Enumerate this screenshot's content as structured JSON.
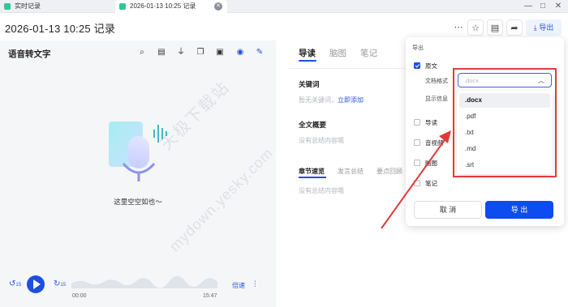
{
  "tabs": [
    {
      "label": "实时记录",
      "active": false
    },
    {
      "label": "2026-01-13 10:25 记录",
      "active": true
    }
  ],
  "window_controls": [
    "—",
    "□",
    "✕"
  ],
  "header": {
    "title": "2026-01-13 10:25 记录",
    "export_label": "导出",
    "icons": [
      "more-icon",
      "star-icon",
      "clipboard-icon",
      "share-icon",
      "download-icon"
    ]
  },
  "left": {
    "title": "语音转文字",
    "tool_icons": [
      "search-icon",
      "document-icon",
      "filter-icon",
      "copy-icon",
      "note-icon",
      "speaker-icon",
      "edit-icon"
    ],
    "empty_text": "这里空空如也～"
  },
  "player": {
    "current_time": "00:00",
    "total_time": "15:47",
    "speed_label": "倍速",
    "rewind_label": "15",
    "forward_label": "15"
  },
  "middle": {
    "tabs": [
      {
        "label": "导读",
        "active": true
      },
      {
        "label": "脑图",
        "active": false
      },
      {
        "label": "笔记",
        "active": false
      }
    ],
    "keywords": {
      "title": "关键词",
      "empty": "暂无关键词，",
      "add_link": "立即添加"
    },
    "summary": {
      "title": "全文概要",
      "empty": "没有总结内容哦"
    },
    "sub_tabs": [
      {
        "label": "章节速览",
        "active": true
      },
      {
        "label": "发言总结",
        "active": false
      },
      {
        "label": "要点回顾",
        "active": false
      }
    ],
    "sub_empty": "没有总结内容哦"
  },
  "export_panel": {
    "heading": "导出",
    "original": {
      "label": "原文",
      "checked": true
    },
    "format_label": "文档格式",
    "format_placeholder": ".docx",
    "display_label": "显示信息",
    "guide": {
      "label": "导读",
      "checked": false
    },
    "audio": {
      "label": "音视频",
      "checked": false
    },
    "mindmap": {
      "label": "脑图",
      "checked": false
    },
    "notes": {
      "label": "笔记",
      "checked": false
    },
    "cancel_label": "取 消",
    "confirm_label": "导 出",
    "format_options": [
      ".docx",
      ".pdf",
      ".txt",
      ".md",
      ".srt"
    ],
    "selected_format": ".docx"
  },
  "watermark": {
    "line1": "天极下载站",
    "line2": "mydown.yesky.com"
  },
  "colors": {
    "accent": "#1d4fe0",
    "highlight": "#e03a3a",
    "panel_bg": "#f5f6f8"
  }
}
